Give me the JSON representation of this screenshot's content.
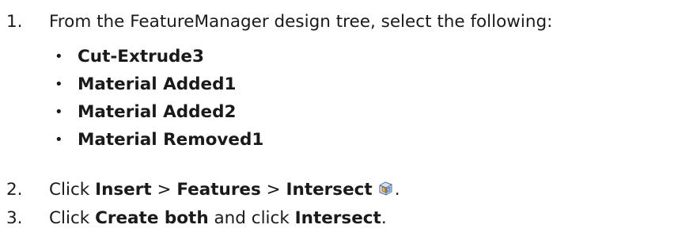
{
  "steps": [
    {
      "num": "1.",
      "text": "From the FeatureManager design tree, select the following:"
    },
    {
      "num": "2.",
      "t1": "Click ",
      "b1": "Insert",
      "sep1": " > ",
      "b2": "Features",
      "sep2": " > ",
      "b3": "Intersect",
      "end": ".",
      "icon": "intersect-icon"
    },
    {
      "num": "3.",
      "t1": "Click ",
      "b1": "Create both",
      "t2": " and click ",
      "b2": "Intersect",
      "end": "."
    }
  ],
  "bullets": [
    "Cut-Extrude3",
    "Material Added1",
    "Material Added2",
    "Material Removed1"
  ]
}
